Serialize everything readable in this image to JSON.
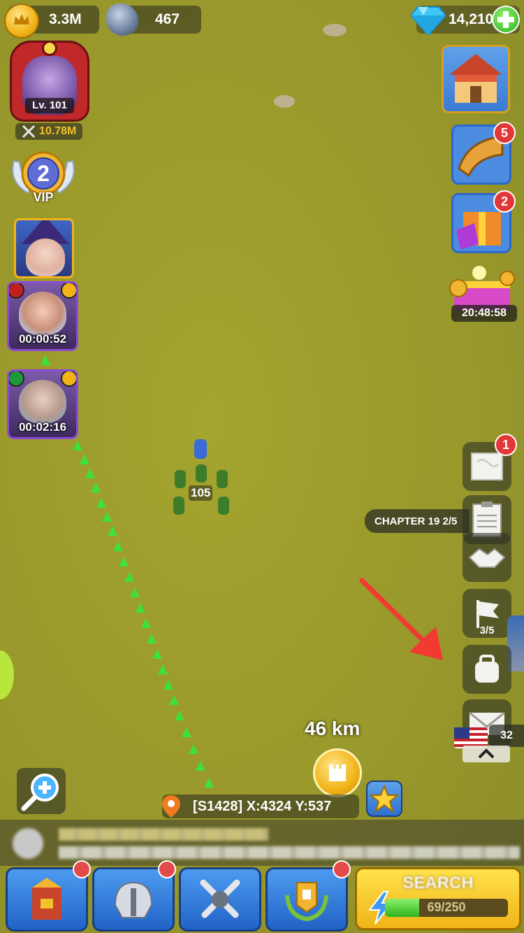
{
  "resources": {
    "gold": "3.3M",
    "stone": "467",
    "gems": "14,210"
  },
  "profile": {
    "level": "Lv. 101",
    "power": "10.78M",
    "vip_level": "2",
    "vip_label": "VIP"
  },
  "heroes": [
    {
      "timer": "00:00:52"
    },
    {
      "timer": "00:02:16"
    }
  ],
  "right_menu": {
    "quest_badge": "5",
    "sale_badge": "2",
    "chest_timer": "20:48:58",
    "map_badge": "1",
    "chapter_label": "CHAPTER 19  2/5",
    "flag_count": "3/5",
    "mail_count": "32"
  },
  "army": {
    "count": "105"
  },
  "map": {
    "distance": "46 km",
    "coords": "[S1428] X:4324 Y:537"
  },
  "bottom": {
    "search_label": "SEARCH",
    "stamina": "69/250",
    "stamina_fraction": 0.276
  },
  "colors": {
    "accent_gold": "#f2c12e",
    "tab_blue": "#2f7de0",
    "badge_red": "#e33636",
    "trail_green": "#3de03d",
    "hint_arrow": "#f03a32"
  }
}
